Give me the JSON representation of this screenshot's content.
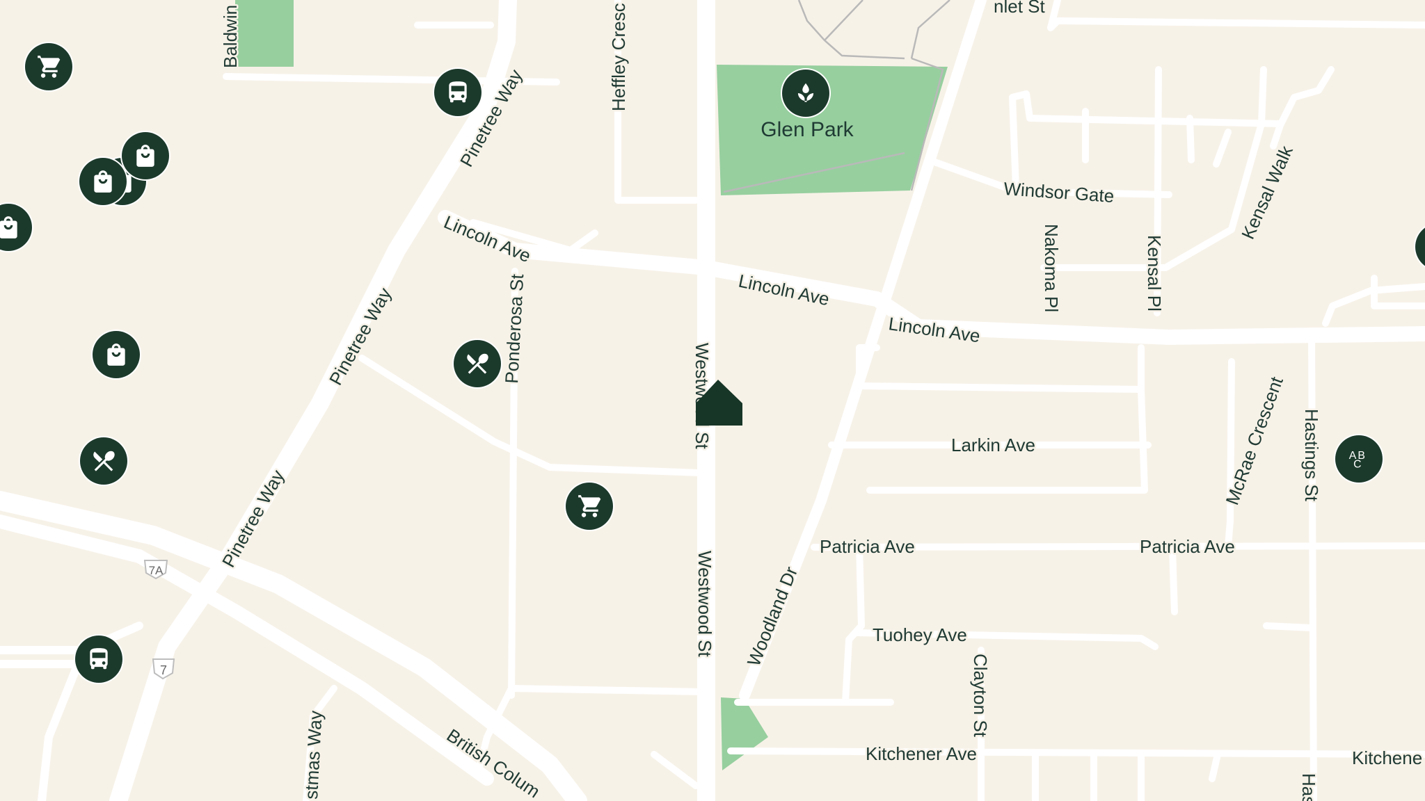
{
  "map": {
    "colors": {
      "land": "#f7f2e8",
      "road": "#ffffff",
      "park": "#97cf9f",
      "poi": "#1c3a2c",
      "label": "#1f3a33"
    },
    "park_label": "Glen Park",
    "streets": {
      "baldwin": "Baldwin",
      "heffley": "Heffley Cresc",
      "inlet": "nlet St",
      "pinetree_1": "Pinetree Way",
      "pinetree_2": "Pinetree Way",
      "pinetree_3": "Pinetree Way",
      "lincoln_1": "Lincoln Ave",
      "lincoln_2": "Lincoln Ave",
      "lincoln_3": "Lincoln Ave",
      "windsor": "Windsor Gate",
      "nakoma": "Nakoma Pl",
      "kensal_pl": "Kensal Pl",
      "kensal_walk": "Kensal Walk",
      "ponderosa": "Ponderosa St",
      "westwood_1": "Westwood St",
      "westwood_2": "Westwood St",
      "larkin": "Larkin Ave",
      "mcrae": "McRae Crescent",
      "hastings_1": "Hastings St",
      "hastings_2": "Has",
      "patricia_1": "Patricia Ave",
      "patricia_2": "Patricia Ave",
      "woodland": "Woodland Dr",
      "tuohey": "Tuohey Ave",
      "clayton": "Clayton St",
      "kitchener_1": "Kitchener Ave",
      "kitchener_2": "Kitchene",
      "christmas": "stmas Way",
      "british": "British Colum"
    },
    "shields": {
      "a": "7A",
      "b": "7"
    },
    "pois": [
      {
        "type": "shopping-cart",
        "name": "grocery"
      },
      {
        "type": "bus",
        "name": "transit-stop"
      },
      {
        "type": "shopping-bag",
        "name": "shop"
      },
      {
        "type": "restaurant",
        "name": "restaurant"
      },
      {
        "type": "school",
        "name": "ab-school",
        "text": "AB C"
      }
    ]
  }
}
